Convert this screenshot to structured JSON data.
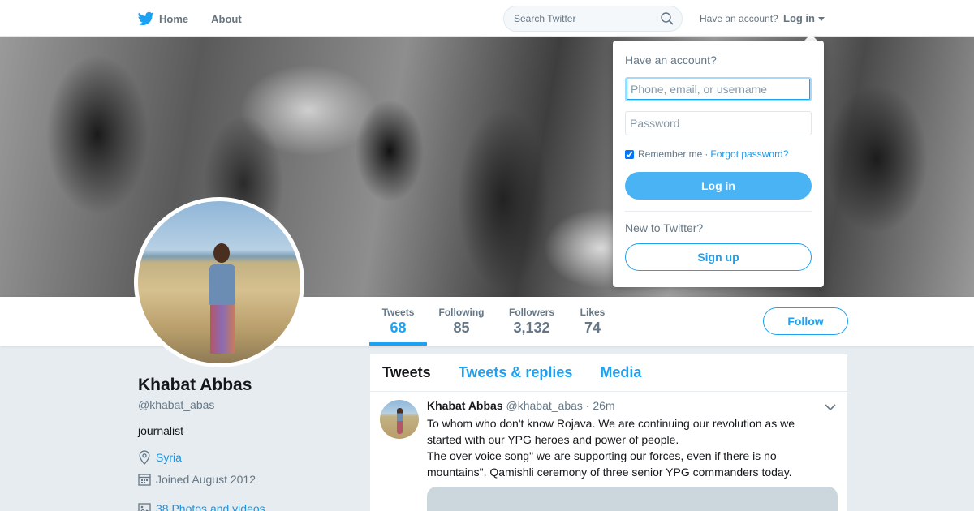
{
  "nav": {
    "home_label": "Home",
    "about_label": "About",
    "search_placeholder": "Search Twitter",
    "account_prompt": "Have an account?",
    "login_label": "Log in"
  },
  "profile": {
    "name": "Khabat Abbas",
    "handle": "@khabat_abas",
    "bio": "journalist",
    "location": "Syria",
    "joined": "Joined August 2012",
    "photos_link": "38 Photos and videos"
  },
  "stats": [
    {
      "label": "Tweets",
      "value": "68"
    },
    {
      "label": "Following",
      "value": "85"
    },
    {
      "label": "Followers",
      "value": "3,132"
    },
    {
      "label": "Likes",
      "value": "74"
    }
  ],
  "follow_label": "Follow",
  "timeline": {
    "tabs": [
      "Tweets",
      "Tweets & replies",
      "Media"
    ],
    "tweet": {
      "name": "Khabat Abbas",
      "handle": "@khabat_abas",
      "time": "· 26m",
      "lines": [
        "To whom who don't know Rojava. We are continuing our revolution as we",
        "started with our YPG heroes and power of people.",
        "The over voice song\" we are supporting our forces, even if there is no",
        "mountains\". Qamishli ceremony of three senior YPG commanders today."
      ]
    }
  },
  "login_dropdown": {
    "title": "Have an account?",
    "username_placeholder": "Phone, email, or username",
    "password_placeholder": "Password",
    "remember_label": "Remember me",
    "separator": "·",
    "forgot_label": "Forgot password?",
    "login_button": "Log in",
    "new_prompt": "New to Twitter?",
    "signup_button": "Sign up"
  },
  "colors": {
    "accent": "#1da1f2",
    "link": "#1b95e0",
    "login_button": "#4ab3f4",
    "page_bg": "#e6ecf0"
  }
}
